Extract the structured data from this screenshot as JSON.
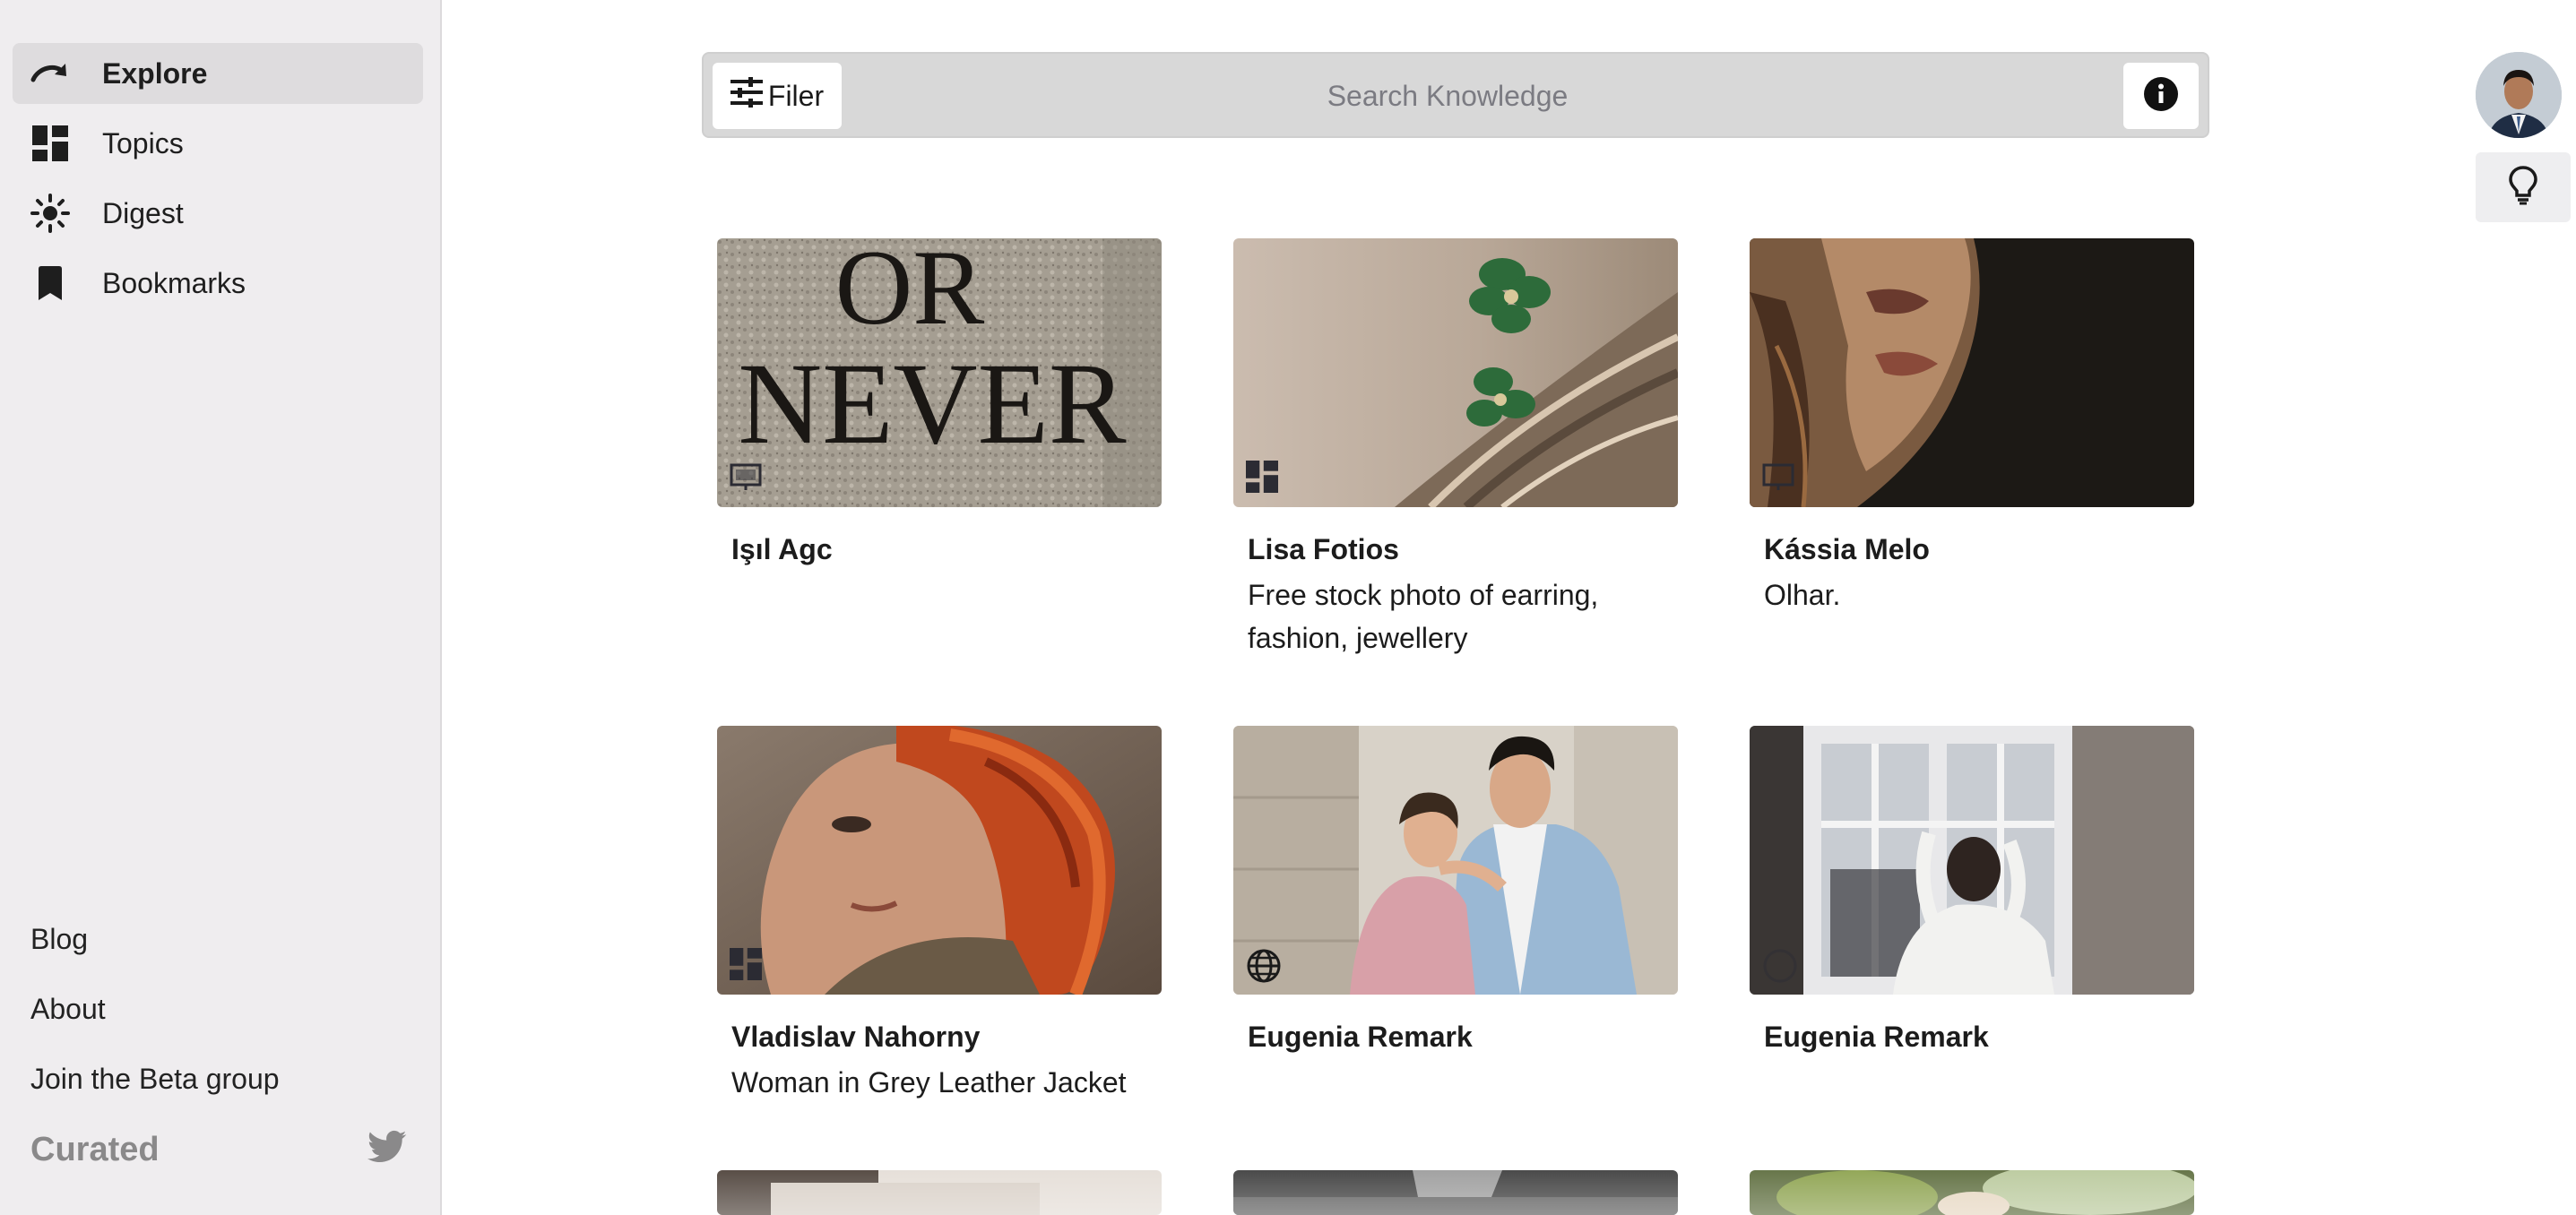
{
  "sidebar": {
    "nav": [
      {
        "label": "Explore",
        "icon": "redo-arrow-icon",
        "active": true
      },
      {
        "label": "Topics",
        "icon": "dashboard-icon",
        "active": false
      },
      {
        "label": "Digest",
        "icon": "sun-icon",
        "active": false
      },
      {
        "label": "Bookmarks",
        "icon": "bookmark-icon",
        "active": false
      }
    ],
    "footer_links": [
      "Blog",
      "About",
      "Join the Beta group"
    ],
    "brand": "Curated",
    "social_icon": "twitter-icon"
  },
  "search": {
    "filter_label": "Filer",
    "placeholder": "Search Knowledge",
    "info_icon": "info-icon"
  },
  "header": {
    "avatar_icon": "avatar",
    "hint_icon": "lightbulb-icon"
  },
  "cards": [
    {
      "title": "Işıl Agc",
      "description": "",
      "type_icon": "slideshow-icon",
      "image_text": [
        "OR",
        "NEVER"
      ]
    },
    {
      "title": "Lisa Fotios",
      "description": "Free stock photo of earring, fashion, jewellery",
      "type_icon": "dashboard-icon"
    },
    {
      "title": "Kássia Melo",
      "description": "Olhar.",
      "type_icon": "slideshow-icon"
    },
    {
      "title": "Vladislav Nahorny",
      "description": "Woman in Grey Leather Jacket",
      "type_icon": "dashboard-icon"
    },
    {
      "title": "Eugenia Remark",
      "description": "",
      "type_icon": "globe-icon"
    },
    {
      "title": "Eugenia Remark",
      "description": "",
      "type_icon": "globe-icon"
    }
  ],
  "colors": {
    "sidebar_bg": "#efedef",
    "active_item_bg": "#dedcde",
    "search_bg": "#d8d8d8",
    "brand_gray": "#8a898a"
  }
}
